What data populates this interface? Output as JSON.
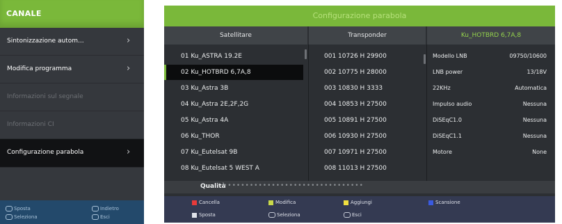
{
  "left_menu": {
    "title": "CANALE",
    "items": [
      {
        "label": "Sintonizzazione autom...",
        "chevron": "›"
      },
      {
        "label": "Modifica programma",
        "chevron": "›"
      },
      {
        "label": "Informazioni sul segnale"
      },
      {
        "label": "Informazioni CI"
      },
      {
        "label": "Configurazione parabola",
        "chevron": "›"
      }
    ],
    "footer": {
      "k1": "Sposta",
      "k2": "Indietro",
      "k3": "Seleziona",
      "k4": "Esci"
    }
  },
  "dish_setup": {
    "title": "Configurazione parabola",
    "columns": {
      "satellite": "Satellitare",
      "transponder": "Transponder",
      "current_satellite": "Ku_HOTBRD 6,7A,8"
    },
    "satellites": [
      "01 Ku_ASTRA 19.2E",
      "02 Ku_HOTBRD 6,7A,8",
      "03 Ku_Astra 3B",
      "04 Ku_Astra 2E,2F,2G",
      "05 Ku_Astra 4A",
      "06 Ku_THOR",
      "07 Ku_Eutelsat 9B",
      "08 Ku_Eutelsat 5 WEST A"
    ],
    "transponders": [
      "001 10726 H 29900",
      "002 10775 H 28000",
      "003 10830 H 3333",
      "004 10853 H 27500",
      "005 10891 H 27500",
      "006 10930 H 27500",
      "007 10971 H 27500",
      "008 11013 H 27500"
    ],
    "settings": [
      {
        "key": "Modello LNB",
        "value": "09750/10600"
      },
      {
        "key": "LNB power",
        "value": "13/18V"
      },
      {
        "key": "22KHz",
        "value": "Automatica"
      },
      {
        "key": "Impulso audio",
        "value": "Nessuna"
      },
      {
        "key": "DiSEqC1.0",
        "value": "Nessuna"
      },
      {
        "key": "DiSEqC1.1",
        "value": "Nessuna"
      },
      {
        "key": "Motore",
        "value": "None"
      }
    ],
    "quality_label": "Qualità",
    "quality_bar": "••••••••••••••••••••••••••••••••",
    "keys": {
      "red": "Cancella",
      "green": "Modifica",
      "yellow": "Aggiungi",
      "blue": "Scansione",
      "move": "Sposta",
      "select": "Seleziona",
      "exit": "Esci"
    }
  },
  "colors": {
    "accent_green": "#7ab83a",
    "red_key": "#e83a3a",
    "green_key": "#c9d94a",
    "yellow_key": "#f0e040",
    "blue_key": "#3a5ae0"
  }
}
